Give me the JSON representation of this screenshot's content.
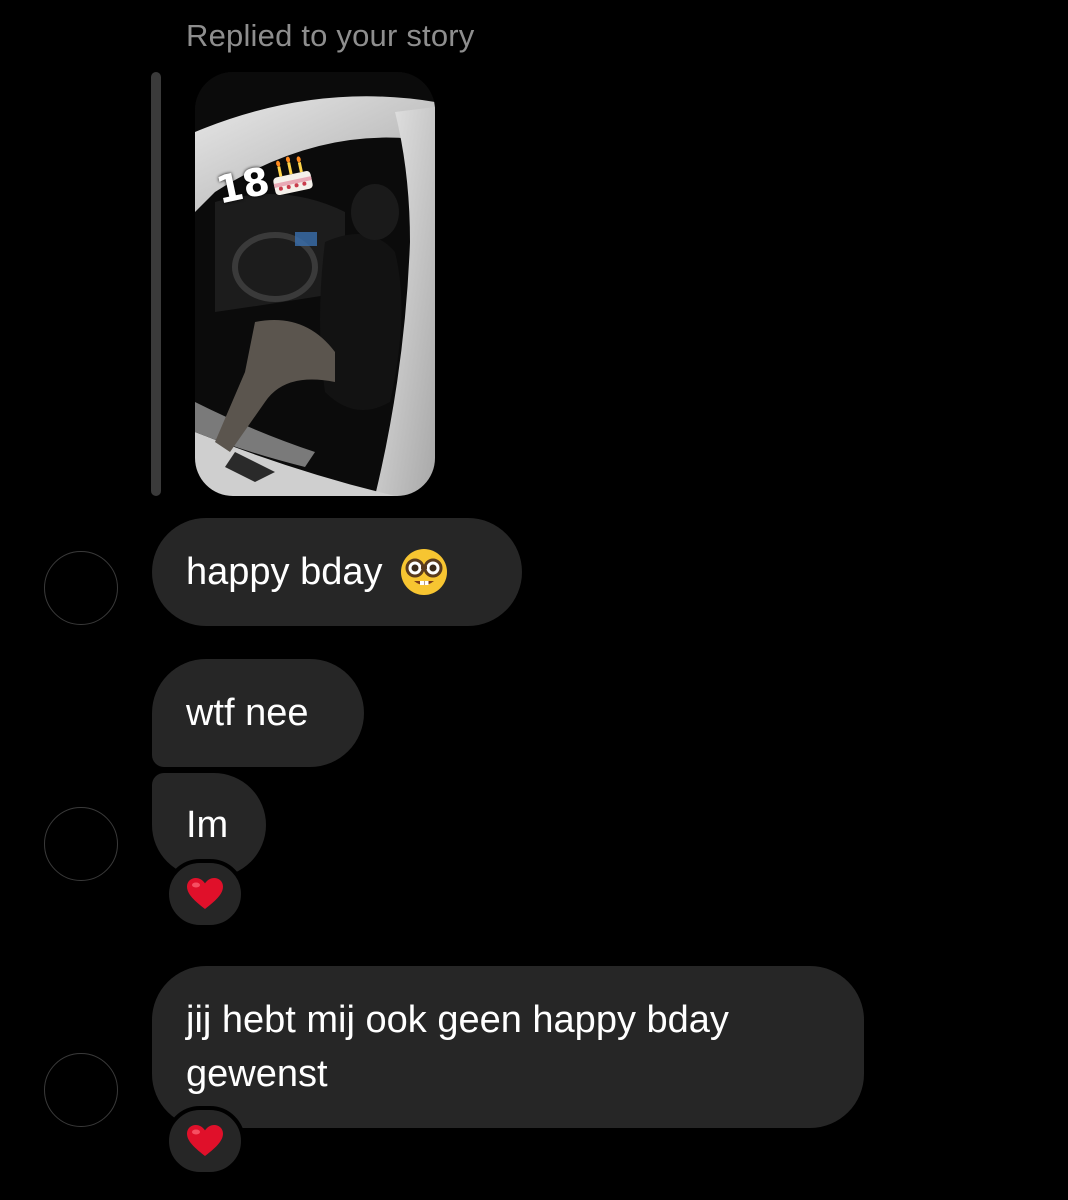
{
  "story_reply": {
    "label": "Replied to your story",
    "sticker_text": "18"
  },
  "messages": [
    {
      "text": "happy bday",
      "emoji": "nerd-face-emoji",
      "has_avatar": true
    },
    {
      "text": "wtf nee",
      "has_avatar": false
    },
    {
      "text": "Im",
      "has_avatar": true,
      "reaction": "heart-emoji"
    },
    {
      "text_line1": "jij hebt mij ook geen happy bday",
      "text_line2": "gewenst",
      "has_avatar": true,
      "reaction": "heart-emoji"
    }
  ],
  "colors": {
    "background": "#000000",
    "bubble": "#262626",
    "secondary_text": "#8e8e8e",
    "heart": "#e0102a"
  }
}
